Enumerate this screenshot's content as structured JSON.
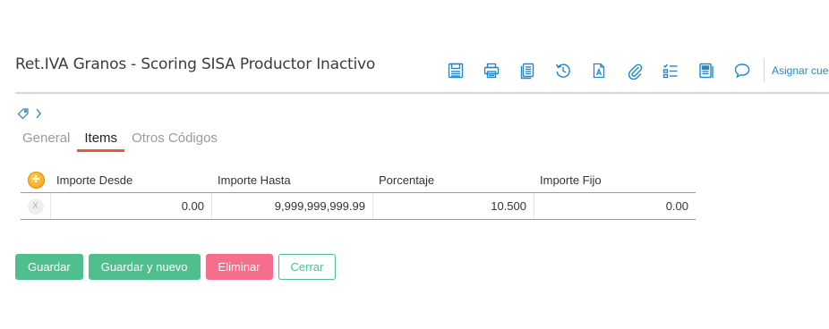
{
  "header": {
    "title": "Ret.IVA Granos - Scoring SISA Productor Inactivo",
    "toolbar": [
      {
        "icon": "save-icon"
      },
      {
        "icon": "print-icon"
      },
      {
        "icon": "copy-icon"
      },
      {
        "icon": "history-icon"
      },
      {
        "icon": "document-text-icon"
      },
      {
        "icon": "attach-icon"
      },
      {
        "icon": "checklist-icon"
      },
      {
        "icon": "notes-icon"
      },
      {
        "icon": "comment-icon"
      }
    ],
    "assign_label": "Asignar cuentas",
    "accent": "#1e88c8"
  },
  "tabs": [
    {
      "label": "General",
      "active": false
    },
    {
      "label": "Items",
      "active": true
    },
    {
      "label": "Otros Códigos",
      "active": false
    }
  ],
  "grid": {
    "add_symbol": "+",
    "remove_symbol": "X",
    "columns": [
      "Importe Desde",
      "Importe Hasta",
      "Porcentaje",
      "Importe Fijo"
    ],
    "rows": [
      [
        "0.00",
        "9,999,999,999.99",
        "10.500",
        "0.00"
      ]
    ]
  },
  "actions": {
    "save": "Guardar",
    "save_new": "Guardar y nuevo",
    "delete": "Eliminar",
    "close": "Cerrar"
  },
  "colors": {
    "primary_green": "#4fc08d",
    "danger_pink": "#f56f8c",
    "tab_underline": "#e05a3c"
  }
}
